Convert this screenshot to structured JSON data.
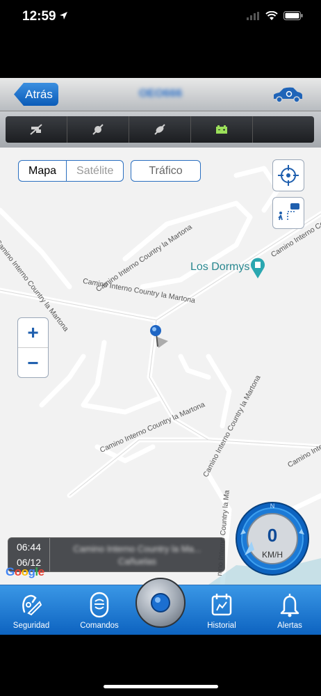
{
  "status": {
    "time": "12:59"
  },
  "nav": {
    "back_label": "Atrás",
    "title": "OEO666"
  },
  "map": {
    "seg_map": "Mapa",
    "seg_satellite": "Satélite",
    "traffic": "Tráfico",
    "poi_name": "Los Dormys",
    "road_labels": [
      "Camino Interno Country la Martona",
      "Camino Interno Country la Martona",
      "Camino Interno Country la Martona",
      "Camino Interno Co",
      "Camino Interno Co",
      "Camino Interno Country la Martona",
      "Camino Interno Country la Martona",
      "nino Interno Country la Ma"
    ],
    "zoom_in": "+",
    "zoom_out": "−"
  },
  "info": {
    "time": "06:44",
    "date": "06/12",
    "address_line1": "Camino Interno Country la Ma...",
    "address_line2": "Cañuelas"
  },
  "google_logo": "Google",
  "speedometer": {
    "value": "0",
    "unit": "KM/H",
    "compass_n": "N"
  },
  "tabs": [
    {
      "label": "Seguridad",
      "icon": "security-icon"
    },
    {
      "label": "Comandos",
      "icon": "commands-icon"
    },
    {
      "label": "Historial",
      "icon": "history-icon"
    },
    {
      "label": "Alertas",
      "icon": "alerts-icon"
    }
  ],
  "colors": {
    "accent": "#0d63c0",
    "map_bg": "#f2f2f2",
    "poi": "#28878f"
  }
}
